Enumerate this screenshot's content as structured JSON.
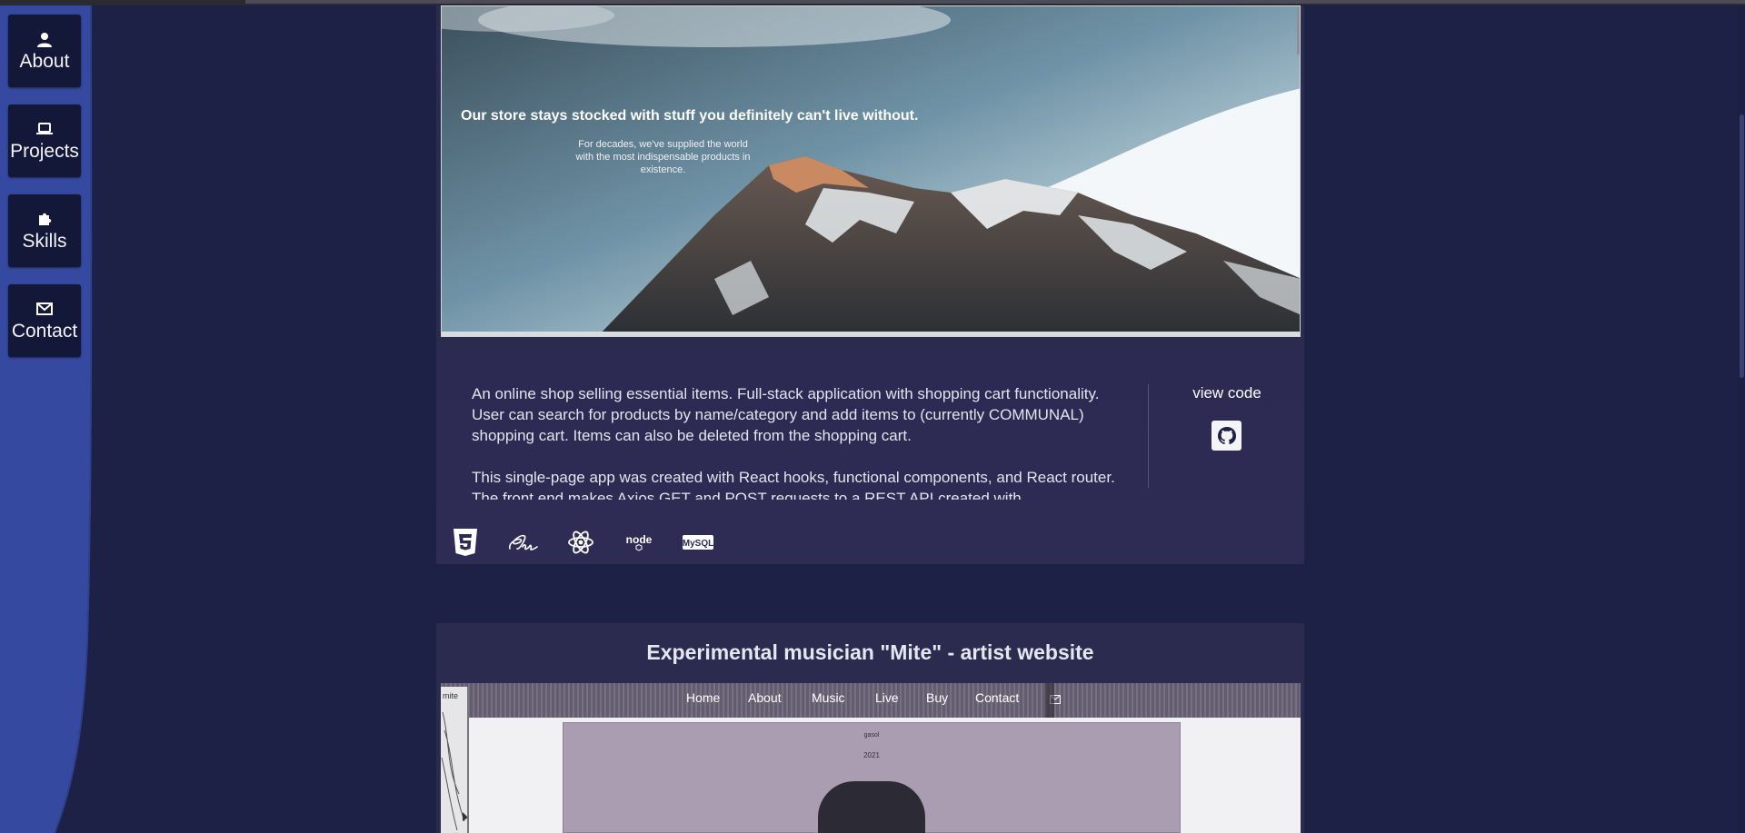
{
  "nav": {
    "items": [
      {
        "label": "About",
        "icon": "user-icon"
      },
      {
        "label": "Projects",
        "icon": "laptop-icon"
      },
      {
        "label": "Skills",
        "icon": "puzzle-icon"
      },
      {
        "label": "Contact",
        "icon": "envelope-icon"
      }
    ]
  },
  "project1": {
    "hero_title": "Our store stays stocked with stuff you definitely can't live without.",
    "hero_subtitle": "For decades, we've supplied the world with the most indispensable products in existence.",
    "description": [
      "An online shop selling essential items. Full-stack application with shopping cart functionality. User can search for products by name/category and add items to (currently COMMUNAL) shopping cart. Items can also be deleted from the shopping cart.",
      "This single-page app was created with React hooks, functional components, and React router. The front end makes Axios GET and POST requests to a REST API created with"
    ],
    "view_code_label": "view code",
    "tech": [
      "html5-icon",
      "sass-icon",
      "react-icon",
      "node-icon",
      "mysql-icon"
    ],
    "tech_labels": {
      "node": "node",
      "mysql": "MySQL"
    }
  },
  "project2": {
    "title": "Experimental musician \"Mite\" - artist website",
    "site_nav": [
      "Home",
      "About",
      "Music",
      "Live",
      "Buy",
      "Contact"
    ],
    "logo_text": "mite",
    "small_text": "gasol",
    "year": "2021"
  },
  "colors": {
    "background": "#1d2146",
    "sidebar_blue": "#3549a0",
    "nav_button": "#141838",
    "card": "#2b2b50"
  }
}
